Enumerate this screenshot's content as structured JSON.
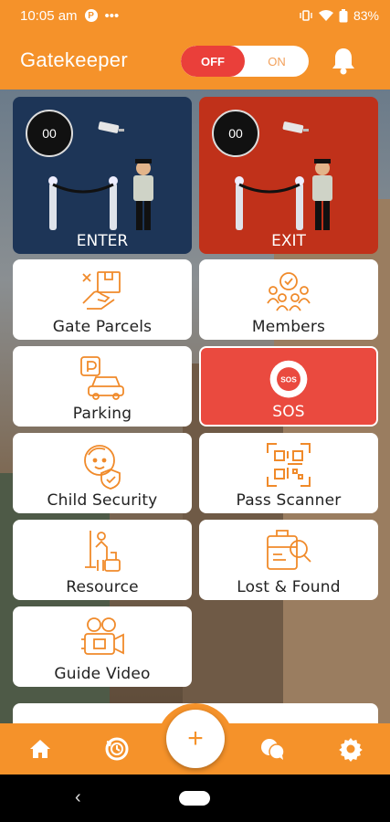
{
  "status_bar": {
    "time": "10:05 am",
    "dots": "•••",
    "battery": "83%"
  },
  "app": {
    "title": "Gatekeeper"
  },
  "toggle": {
    "off_label": "OFF",
    "on_label": "ON",
    "state": "off"
  },
  "colors": {
    "primary": "#f5922a",
    "enter_bg": "#1d3557",
    "exit_bg": "#c0311a",
    "sos_bg": "#ea4a3f",
    "toggle_off": "#ea3f3a"
  },
  "enter": {
    "count": "00",
    "label": "ENTER"
  },
  "exit": {
    "count": "00",
    "label": "EXIT"
  },
  "tiles": [
    {
      "label": "Gate Parcels",
      "icon": "parcel-hand-icon"
    },
    {
      "label": "Members",
      "icon": "members-group-icon"
    },
    {
      "label": "Parking",
      "icon": "parking-car-icon"
    },
    {
      "label": "SOS",
      "icon": "sos-icon"
    },
    {
      "label": "Child Security",
      "icon": "child-shield-icon"
    },
    {
      "label": "Pass Scanner",
      "icon": "qr-scanner-icon"
    },
    {
      "label": "Resource",
      "icon": "cleaning-resource-icon"
    },
    {
      "label": "Lost & Found",
      "icon": "lost-found-icon"
    },
    {
      "label": "Guide Video",
      "icon": "video-camera-icon"
    }
  ],
  "bottom_nav": {
    "items": [
      "home-icon",
      "history-icon",
      "add-icon",
      "chat-icon",
      "settings-icon"
    ],
    "fab_label": "+"
  }
}
